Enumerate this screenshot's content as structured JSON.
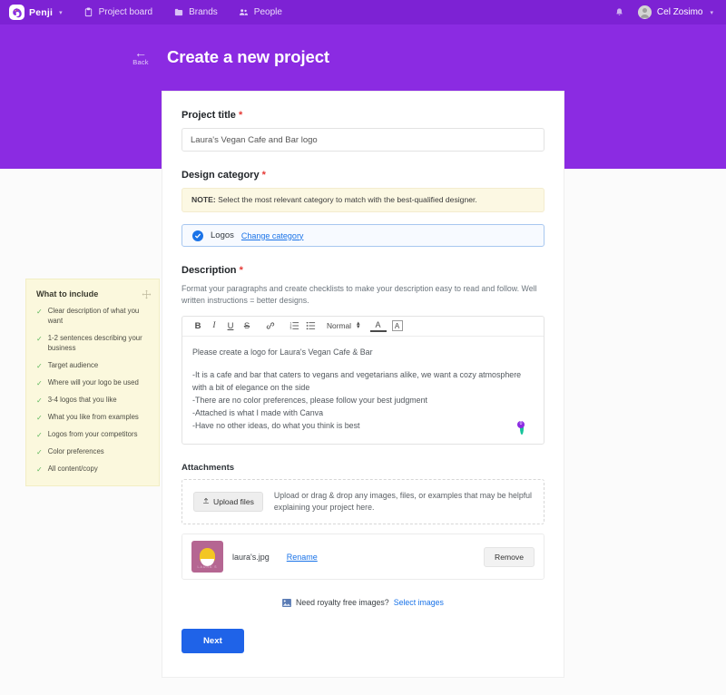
{
  "navbar": {
    "brand": "Penji",
    "brand_caret": "▾",
    "items": [
      {
        "label": "Project board",
        "icon": "clipboard-icon"
      },
      {
        "label": "Brands",
        "icon": "folder-icon"
      },
      {
        "label": "People",
        "icon": "people-icon"
      }
    ],
    "bell_icon": "bell-icon",
    "user_name": "Cel Zosimo",
    "user_caret": "▾"
  },
  "header": {
    "back_label": "Back",
    "back_arrow": "←",
    "title": "Create a new project"
  },
  "form": {
    "project_title": {
      "label": "Project title",
      "required": "*",
      "value": "Laura's Vegan Cafe and Bar logo",
      "placeholder": "Project title"
    },
    "design_category": {
      "label": "Design category",
      "required": "*",
      "note_prefix": "NOTE:",
      "note_text": " Select the most relevant category to match with the best-qualified designer.",
      "selected": "Logos",
      "change_link": "Change category"
    },
    "description": {
      "label": "Description",
      "required": "*",
      "helper": "Format your paragraphs and create checklists to make your description easy to read and follow. Well written instructions = better designs.",
      "toolbar": {
        "bold": "B",
        "italic": "I",
        "underline": "U",
        "strike": "S",
        "link": "link-icon",
        "ordered_list": "ordered-list-icon",
        "bullet_list": "bullet-list-icon",
        "format_select": "Normal",
        "text_color": "A",
        "background_color": "A"
      },
      "lines": [
        "Please create a logo for Laura's Vegan Cafe & Bar",
        "",
        "-It is a cafe and bar that caters to vegans and vegetarians alike, we want a cozy atmosphere with a bit of elegance on the side",
        "-There are no color preferences, please follow your best judgment",
        "-Attached is what I made with Canva",
        "-Have no other ideas, do what you think is best"
      ],
      "grammarly_count": "0"
    },
    "attachments": {
      "title": "Attachments",
      "upload_button": "Upload files",
      "dropzone_text": "Upload or drag & drop any images, files, or examples that may be helpful explaining your project here.",
      "file": {
        "name": "laura's.jpg",
        "rename_label": "Rename",
        "remove_label": "Remove",
        "thumb_text": "LAURA'S"
      }
    },
    "royalty": {
      "icon": "image-icon",
      "text": "Need royalty free images?",
      "link": "Select images"
    },
    "next_button": "Next"
  },
  "tips": {
    "title": "What to include",
    "move_icon": "move-handle-icon",
    "items": [
      "Clear description of what you want",
      "1-2 sentences describing your business",
      "Target audience",
      "Where will your logo be used",
      "3-4 logos that you like",
      "What you like from examples",
      "Logos from your competitors",
      "Color preferences",
      "All content/copy"
    ]
  },
  "colors": {
    "banner_purple": "#8b2be2",
    "navbar_purple": "#7d22d4",
    "accent_blue": "#1a73e8",
    "primary_button": "#1f63e8",
    "note_yellow": "#fcf8e3",
    "tips_yellow": "#fbf8dd",
    "required_red": "#e53935",
    "check_green": "#5cb85c"
  }
}
